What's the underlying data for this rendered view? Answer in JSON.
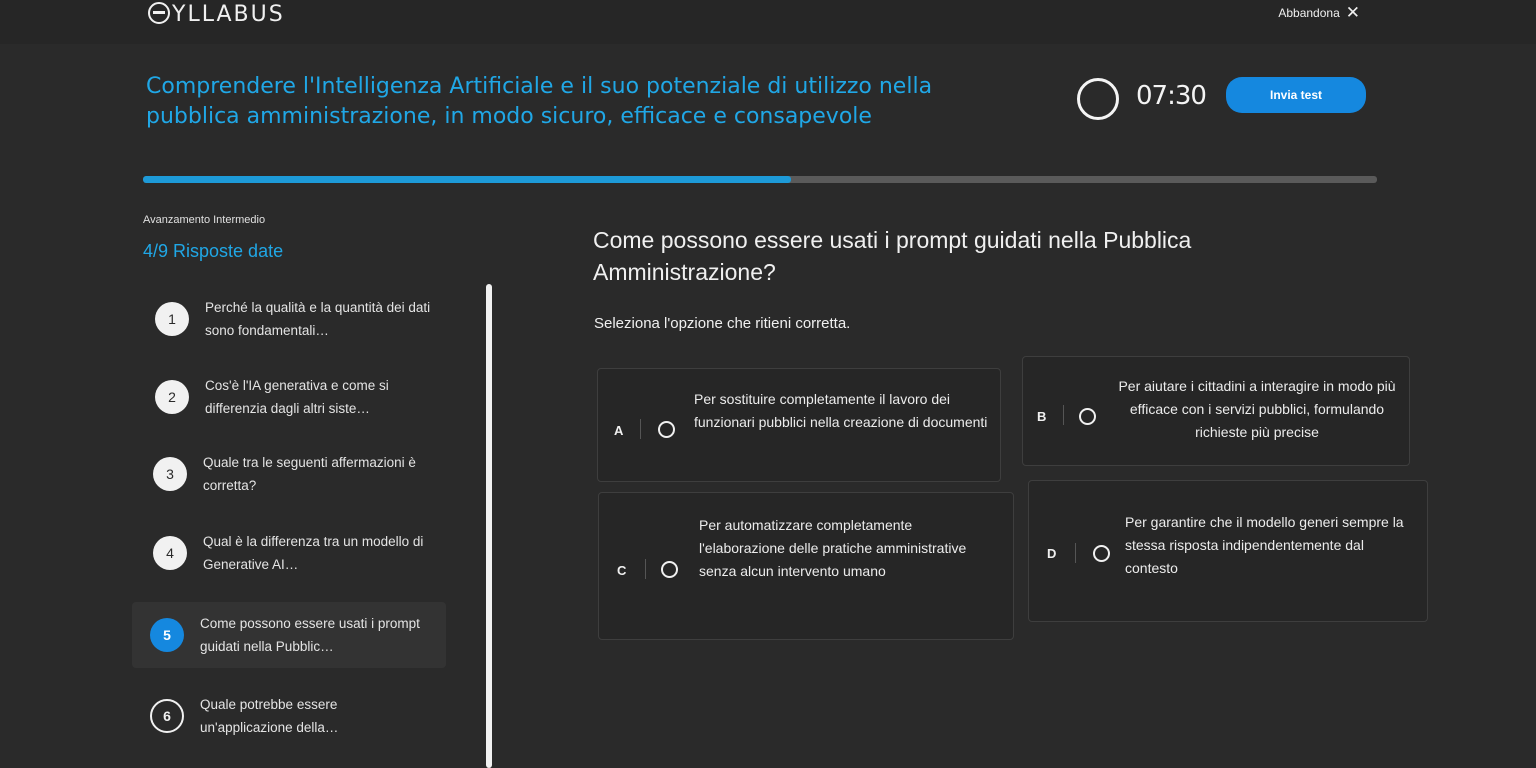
{
  "header": {
    "logo": "SYLLABUS",
    "abandon_label": "Abbandona",
    "abandon_icon": "close-icon"
  },
  "course": {
    "title": "Comprendere l'Intelligenza Artificiale e il suo potenziale di utilizzo nella pubblica amministrazione, in modo sicuro, efficace e consapevole"
  },
  "timer": {
    "value": "07:30"
  },
  "submit": {
    "label": "Invia test"
  },
  "progress": {
    "fraction": 0.525,
    "level_label": "Avanzamento Intermedio",
    "answered_label": "4/9 Risposte date"
  },
  "sidebar": {
    "questions": [
      {
        "number": "1",
        "text": "Perché la qualità e la quantità dei dati sono fondamentali…",
        "state": "answered"
      },
      {
        "number": "2",
        "text": "Cos'è l'IA generativa e come si differenzia dagli altri siste…",
        "state": "answered"
      },
      {
        "number": "3",
        "text": "Quale tra le seguenti affermazioni è corretta?",
        "state": "answered"
      },
      {
        "number": "4",
        "text": "Qual è la differenza tra un modello di Generative AI…",
        "state": "answered"
      },
      {
        "number": "5",
        "text": "Come possono essere usati i prompt guidati nella Pubblic…",
        "state": "active"
      },
      {
        "number": "6",
        "text": "Quale potrebbe essere un'applicazione della…",
        "state": "unanswered"
      }
    ]
  },
  "main": {
    "question": "Come possono essere usati i prompt guidati nella Pubblica Amministrazione?",
    "instruction": "Seleziona l'opzione che ritieni corretta.",
    "options": [
      {
        "letter": "A",
        "text": "Per sostituire completamente il lavoro dei funzionari pubblici nella creazione di documenti"
      },
      {
        "letter": "B",
        "text": "Per aiutare i cittadini a interagire in modo più efficace con i servizi pubblici, formulando richieste più precise"
      },
      {
        "letter": "C",
        "text": "Per automatizzare completamente l'elaborazione delle pratiche amministrative senza alcun intervento umano"
      },
      {
        "letter": "D",
        "text": "Per garantire che il modello generi sempre la stessa risposta indipendentemente dal contesto"
      }
    ]
  },
  "colors": {
    "accent": "#1588df",
    "title_blue": "#20a7e6",
    "background": "#2a2a2a"
  }
}
